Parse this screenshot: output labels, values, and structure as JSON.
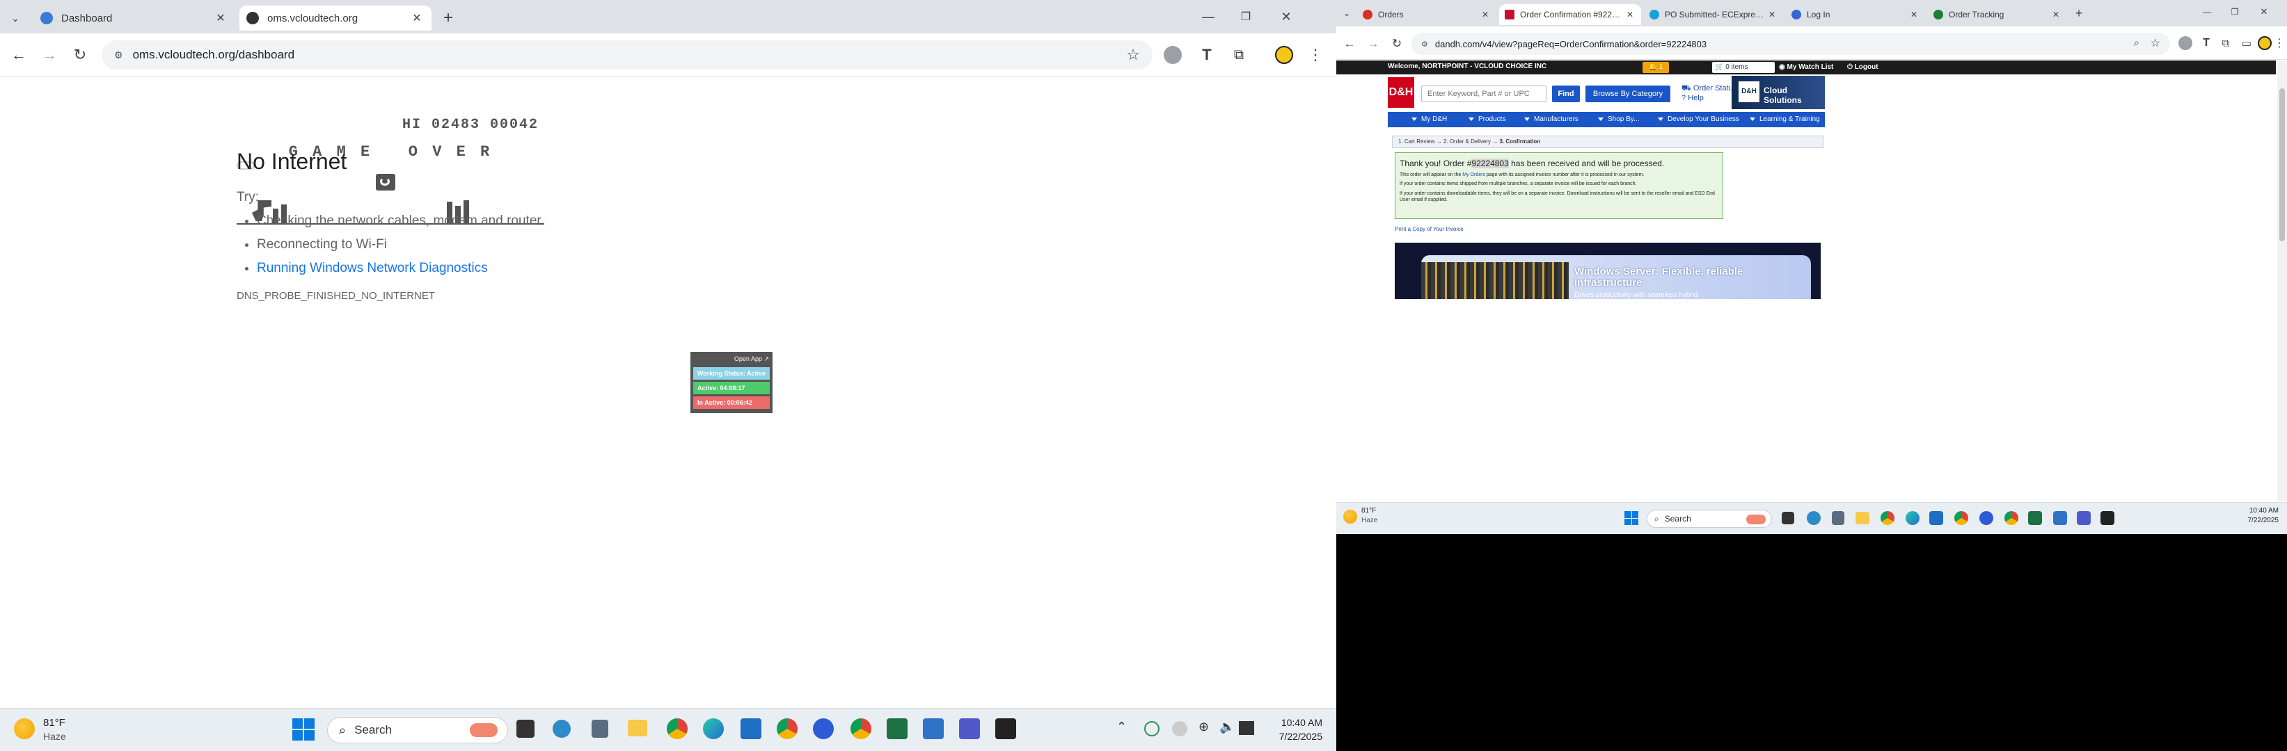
{
  "left_window": {
    "tabs": [
      {
        "label": "Dashboard",
        "active": false
      },
      {
        "label": "oms.vcloudtech.org",
        "active": true
      }
    ],
    "url": "oms.vcloudtech.org/dashboard",
    "dino_game": {
      "score_text": "HI 02483 00042",
      "game_over_text": "G A M E   O V E R"
    },
    "error": {
      "heading": "No Internet",
      "try_label": "Try:",
      "suggestions": [
        "Checking the network cables, modem and router",
        "Reconnecting to Wi-Fi"
      ],
      "diagnostics_link": "Running Windows Network Diagnostics",
      "error_code": "DNS_PROBE_FINISHED_NO_INTERNET"
    },
    "status_widget": {
      "open_app": "Open App ↗",
      "working_status": "Working Status: Active",
      "active": "Active: 04:08:17",
      "inactive": "In Active: 00:06:42"
    },
    "taskbar": {
      "weather_temp": "81°F",
      "weather_desc": "Haze",
      "search_label": "Search",
      "time": "10:40 AM",
      "date": "7/22/2025"
    }
  },
  "right_window": {
    "tabs": [
      {
        "label": "Orders",
        "active": false
      },
      {
        "label": "Order Confirmation #92224803",
        "active": true
      },
      {
        "label": "PO Submitted- ECExpress -",
        "active": false
      },
      {
        "label": "Log In",
        "active": false
      },
      {
        "label": "Order Tracking",
        "active": false
      }
    ],
    "url": "dandh.com/v4/view?pageReq=OrderConfirmation&order=92224803",
    "topbar": {
      "welcome": "Welcome, NORTHPOINT - VCLOUD CHOICE INC",
      "alert_count": "1",
      "cart": "0 items",
      "watch_list": "My Watch List",
      "logout": "Logout"
    },
    "header": {
      "logo": "D&H",
      "search_placeholder": "Enter Keyword, Part # or UPC",
      "find": "Find",
      "browse": "Browse By Category",
      "order_status": "Order Status",
      "help": "Help",
      "banner_logo": "D&H",
      "banner_text": "Cloud Solutions"
    },
    "nav": [
      "My D&H",
      "Products",
      "Manufacturers",
      "Shop By...",
      "Develop Your Business",
      "Learning & Training"
    ],
    "breadcrumb": {
      "step1": "1. Cart Review",
      "arrow": "→",
      "step2": "2. Order & Delivery",
      "step3": "3. Confirmation"
    },
    "confirmation": {
      "thank_prefix": "Thank you! Order #",
      "order_number": "92224803",
      "thank_suffix": " has been received and will be processed.",
      "line1_prefix": "This order will appear on the ",
      "line1_link": "My Orders",
      "line1_suffix": " page with its assigned invoice number after it is processed in our system.",
      "line2": "If your order contains items shipped from multiple branches, a separate invoice will be issued for each branch.",
      "line3": "If your order contains downloadable items, they will be on a separate invoice. Download instructions will be sent to the reseller email and ESD End User email if supplied."
    },
    "print_link": "Print a Copy of Your Invoice",
    "promo": {
      "headline": "Windows Server: Flexible, reliable infrastructure",
      "sub": "Drives productivity with seamless hybrid"
    },
    "taskbar": {
      "weather_temp": "81°F",
      "weather_desc": "Haze",
      "search_label": "Search",
      "time": "10:40 AM",
      "date": "7/22/2025"
    }
  }
}
